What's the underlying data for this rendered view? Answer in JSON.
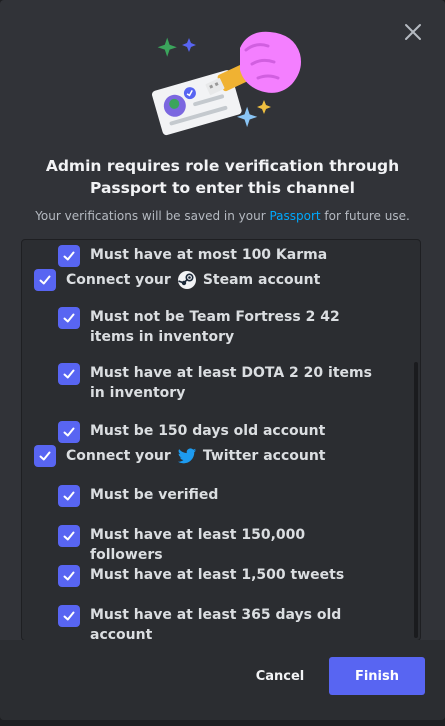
{
  "modal": {
    "title_line1": "Admin requires role verification through",
    "title_line2": "Passport to enter this channel",
    "subtitle_pre": "Your verifications will be saved in your ",
    "subtitle_link": "Passport",
    "subtitle_post": " for future use."
  },
  "close_icon": "close-icon",
  "requirements": {
    "top_item": {
      "label": "Must have at most 100 Karma",
      "checked": true
    },
    "steam": {
      "prefix": "Connect your",
      "service": "Steam account",
      "icon": "steam-icon",
      "checked": true,
      "items": [
        {
          "label": "Must not be Team Fortress 2 42 items in inventory",
          "checked": true
        },
        {
          "label": "Must have at least DOTA 2 20 items in inventory",
          "checked": true
        },
        {
          "label": "Must be 150 days old account",
          "checked": true
        }
      ]
    },
    "twitter": {
      "prefix": "Connect your",
      "service": "Twitter account",
      "icon": "twitter-icon",
      "checked": true,
      "items": [
        {
          "label": "Must be verified",
          "checked": true
        },
        {
          "label": "Must have at least 150,000 followers",
          "checked": true
        },
        {
          "label": "Must have at least 1,500 tweets",
          "checked": true
        },
        {
          "label": "Must have at least 365 days old account",
          "checked": true
        }
      ]
    }
  },
  "footer": {
    "cancel_label": "Cancel",
    "finish_label": "Finish"
  },
  "colors": {
    "accent": "#5865f2",
    "link": "#00a8fc",
    "background": "#313338",
    "twitter": "#1d9bf0"
  }
}
